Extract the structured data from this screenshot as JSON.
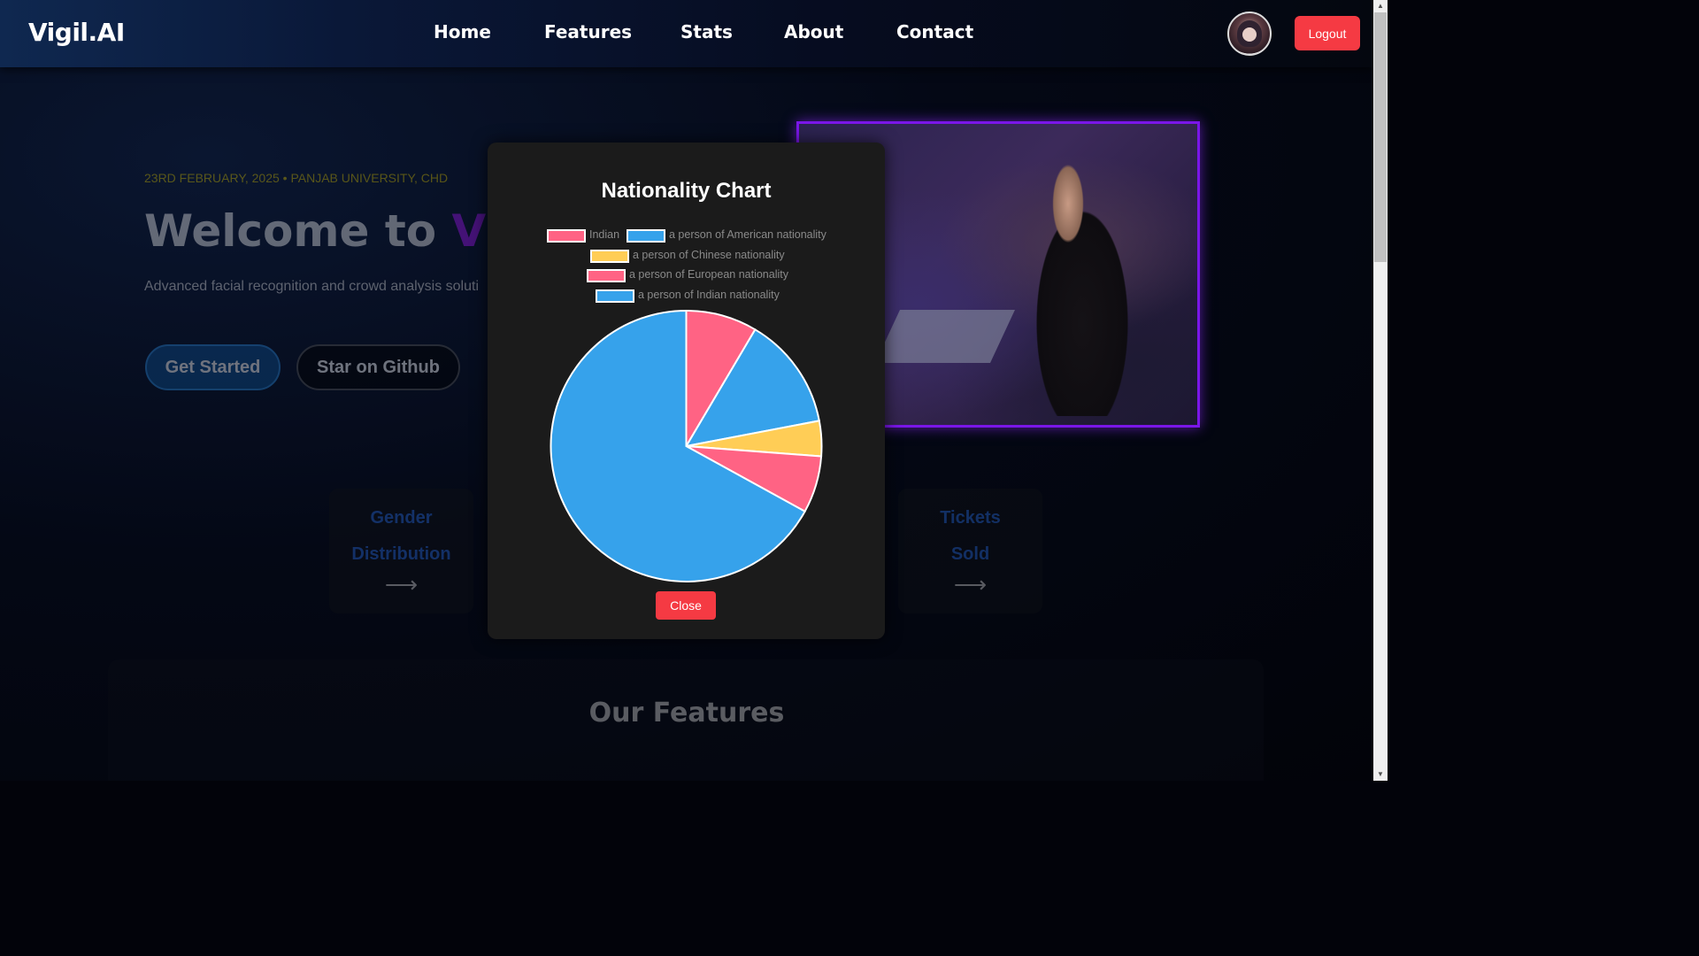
{
  "nav": {
    "logo": "Vigil.AI",
    "links": [
      "Home",
      "Features",
      "Stats",
      "About",
      "Contact"
    ],
    "logout_label": "Logout"
  },
  "hero": {
    "date_location": "23RD FEBRUARY, 2025 • PANJAB UNIVERSITY, CHD",
    "title_prefix": "Welcome to ",
    "title_accent": "Vigi",
    "subtitle": "Advanced facial recognition and crowd analysis soluti",
    "get_started": "Get Started",
    "star_github": "Star on Github"
  },
  "cards": [
    {
      "line1": "Gender",
      "line2": "Distribution",
      "arrow": "⟶"
    },
    {
      "line1": "Tickets",
      "line2": "Sold",
      "arrow": "⟶"
    }
  ],
  "features_title": "Our Features",
  "modal": {
    "title": "Nationality Chart",
    "close_label": "Close"
  },
  "chart_data": {
    "type": "pie",
    "title": "Nationality Chart",
    "legend_position": "top",
    "series": [
      {
        "name": "Indian",
        "value": 8.5,
        "color": "#ff6384"
      },
      {
        "name": "a person of American nationality",
        "value": 13.5,
        "color": "#36a2eb"
      },
      {
        "name": "a person of Chinese nationality",
        "value": 4.2,
        "color": "#ffcd56"
      },
      {
        "name": "a person of European nationality",
        "value": 6.8,
        "color": "#ff6384"
      },
      {
        "name": "a person of Indian nationality",
        "value": 67.0,
        "color": "#36a2eb"
      }
    ]
  }
}
